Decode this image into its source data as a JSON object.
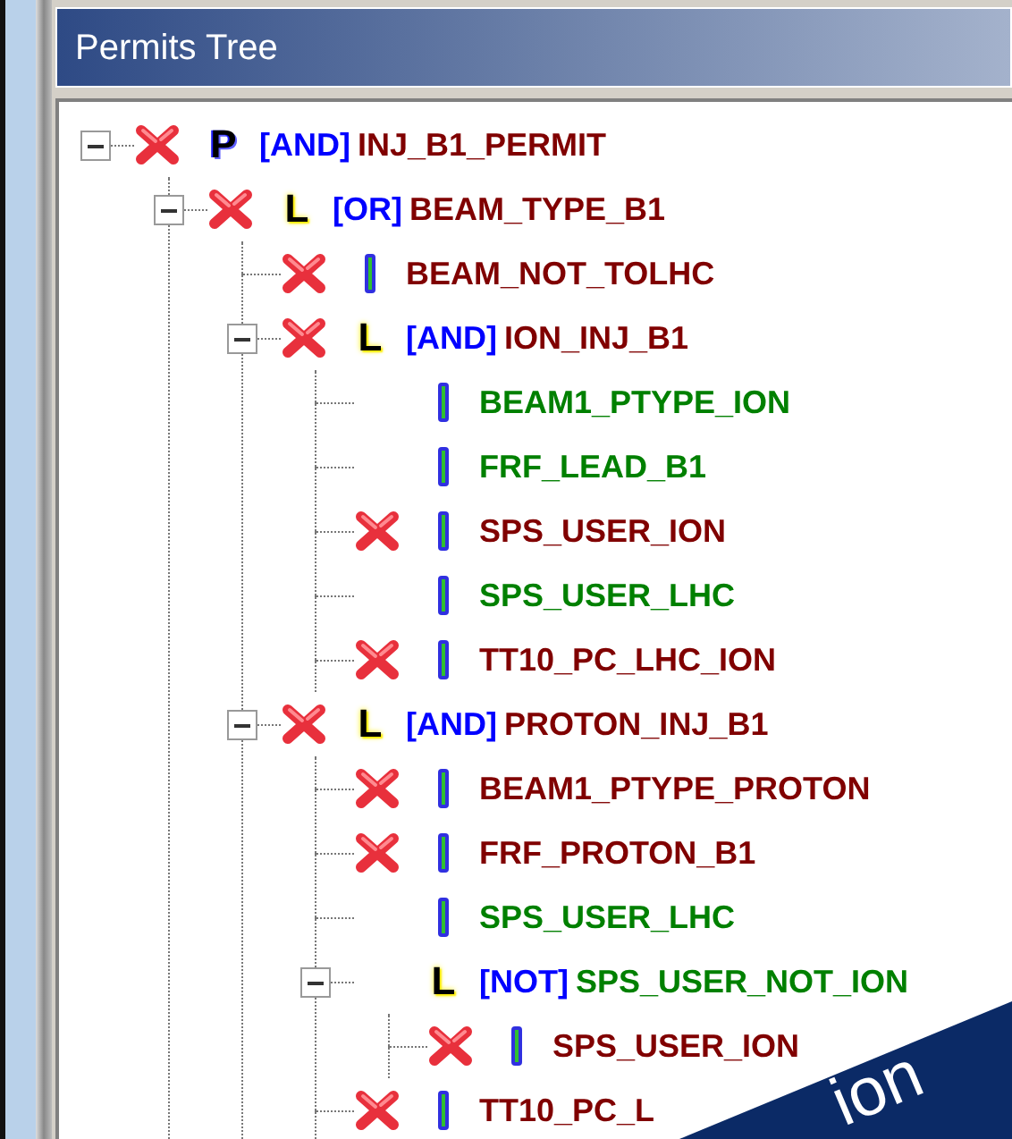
{
  "panel": {
    "title": "Permits Tree"
  },
  "tree": [
    {
      "kind": "permit",
      "letter": "P",
      "operator": "[AND]",
      "name": "INJ_B1_PERMIT",
      "failed": true,
      "expanded": true,
      "children": [
        {
          "kind": "logic",
          "letter": "L",
          "operator": "[OR]",
          "name": "BEAM_TYPE_B1",
          "failed": true,
          "expanded": true,
          "children": [
            {
              "kind": "input",
              "name": "BEAM_NOT_TOLHC",
              "failed": true
            },
            {
              "kind": "logic",
              "letter": "L",
              "operator": "[AND]",
              "name": "ION_INJ_B1",
              "failed": true,
              "expanded": true,
              "children": [
                {
                  "kind": "input",
                  "name": "BEAM1_PTYPE_ION",
                  "failed": false
                },
                {
                  "kind": "input",
                  "name": "FRF_LEAD_B1",
                  "failed": false
                },
                {
                  "kind": "input",
                  "name": "SPS_USER_ION",
                  "failed": true
                },
                {
                  "kind": "input",
                  "name": "SPS_USER_LHC",
                  "failed": false
                },
                {
                  "kind": "input",
                  "name": "TT10_PC_LHC_ION",
                  "failed": true
                }
              ]
            },
            {
              "kind": "logic",
              "letter": "L",
              "operator": "[AND]",
              "name": "PROTON_INJ_B1",
              "failed": true,
              "expanded": true,
              "children": [
                {
                  "kind": "input",
                  "name": "BEAM1_PTYPE_PROTON",
                  "failed": true
                },
                {
                  "kind": "input",
                  "name": "FRF_PROTON_B1",
                  "failed": true
                },
                {
                  "kind": "input",
                  "name": "SPS_USER_LHC",
                  "failed": false
                },
                {
                  "kind": "logic",
                  "letter": "L",
                  "operator": "[NOT]",
                  "name": "SPS_USER_NOT_ION",
                  "failed": false,
                  "expanded": true,
                  "children": [
                    {
                      "kind": "input",
                      "name": "SPS_USER_ION",
                      "failed": true
                    }
                  ]
                },
                {
                  "kind": "input",
                  "name": "TT10_PC_L",
                  "failed": true
                }
              ]
            }
          ]
        }
      ]
    }
  ],
  "banner": {
    "text": "ion"
  }
}
